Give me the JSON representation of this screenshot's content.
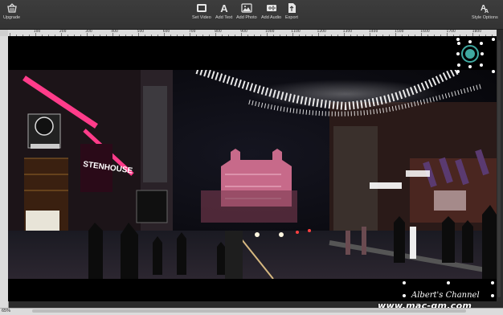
{
  "toolbar": {
    "upgrade_label": "Upgrade",
    "set_video_label": "Set Video",
    "add_text_label": "Add Text",
    "add_photo_label": "Add Photo",
    "add_audio_label": "Add Audio",
    "export_label": "Export",
    "style_options_label": "Style Options"
  },
  "ruler": {
    "labels": [
      "100",
      "200",
      "300",
      "400",
      "500",
      "600",
      "700",
      "800",
      "900",
      "1000",
      "1100",
      "1200",
      "1300",
      "1400",
      "1500",
      "1600",
      "1700",
      "1800"
    ]
  },
  "status": {
    "zoom": "65%"
  },
  "watermark": {
    "line1": "Albert's Channel",
    "line2": "www.mac-gm.com"
  },
  "colors": {
    "toolbar_bg": "#383838",
    "canvas_bg": "#000000",
    "ruler_bg": "#dcdcdc",
    "accent_teal": "#3fa9a0"
  }
}
